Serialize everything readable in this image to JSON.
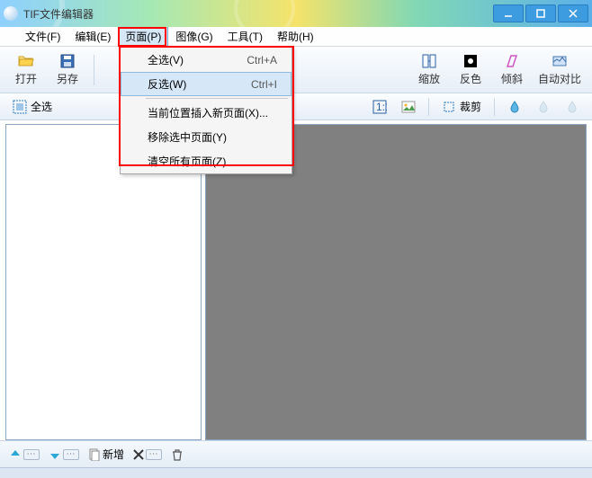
{
  "title": "TIF文件编辑器",
  "window": {
    "min": "minimize",
    "max": "maximize",
    "close": "close"
  },
  "menubar": {
    "file": "文件(F)",
    "edit": "编辑(E)",
    "page": "页面(P)",
    "image": "图像(G)",
    "tools": "工具(T)",
    "help": "帮助(H)"
  },
  "toolbar": {
    "open": "打开",
    "save_as": "另存",
    "zoom": "缩放",
    "invert": "反色",
    "skew": "倾斜",
    "autocontrast": "自动对比"
  },
  "toolbar2": {
    "select_all": "全选",
    "crop": "裁剪"
  },
  "dropdown": {
    "select_all": {
      "label": "全选(V)",
      "shortcut": "Ctrl+A"
    },
    "invert_sel": {
      "label": "反选(W)",
      "shortcut": "Ctrl+I"
    },
    "insert_page": {
      "label": "当前位置插入新页面(X)..."
    },
    "remove_sel": {
      "label": "移除选中页面(Y)"
    },
    "clear_all": {
      "label": "清空所有页面(Z)"
    }
  },
  "bottombar": {
    "add": "新增"
  }
}
